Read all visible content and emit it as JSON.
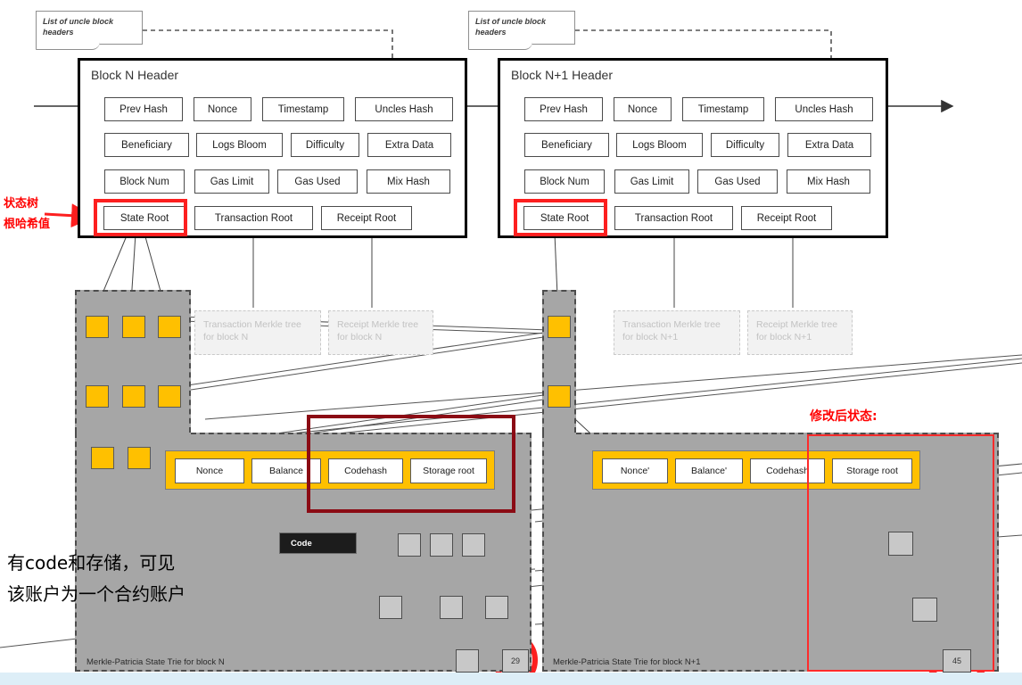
{
  "notes": [
    {
      "id": "uncle-note-left",
      "text": "List of uncle block headers"
    },
    {
      "id": "uncle-note-right",
      "text": "List of uncle block headers"
    }
  ],
  "blocks": [
    {
      "id": "block-n",
      "title": "Block N Header",
      "rows": [
        [
          "Prev Hash",
          "Nonce",
          "Timestamp",
          "Uncles Hash"
        ],
        [
          "Beneficiary",
          "Logs Bloom",
          "Difficulty",
          "Extra Data"
        ],
        [
          "Block Num",
          "Gas Limit",
          "Gas Used",
          "Mix  Hash"
        ],
        [
          "State Root",
          "Transaction Root",
          "Receipt Root"
        ]
      ]
    },
    {
      "id": "block-n1",
      "title": "Block N+1 Header",
      "rows": [
        [
          "Prev Hash",
          "Nonce",
          "Timestamp",
          "Uncles Hash"
        ],
        [
          "Beneficiary",
          "Logs Bloom",
          "Difficulty",
          "Extra Data"
        ],
        [
          "Block Num",
          "Gas Limit",
          "Gas Used",
          "Mix  Hash"
        ],
        [
          "State Root",
          "Transaction Root",
          "Receipt Root"
        ]
      ]
    }
  ],
  "ghost_boxes": [
    {
      "id": "tx-merkle-n",
      "text": "Transaction Merkle tree for block N"
    },
    {
      "id": "receipt-merkle-n",
      "text": "Receipt  Merkle tree for block N"
    },
    {
      "id": "tx-merkle-n1",
      "text": "Transaction Merkle tree for block N+1"
    },
    {
      "id": "receipt-merkle-n1",
      "text": "Receipt  Merkle tree for block N+1"
    }
  ],
  "trie_labels": [
    {
      "id": "trie-label-n",
      "text": "Merkle-Patricia  State  Trie  for block N"
    },
    {
      "id": "trie-label-n1",
      "text": "Merkle-Patricia  State  Trie  for block N+1"
    }
  ],
  "accounts": {
    "left": {
      "id": "account-n",
      "slots": [
        "Nonce",
        "Balance",
        "Codehash",
        "Storage root"
      ]
    },
    "right": {
      "id": "account-n1",
      "slots": [
        "Nonce'",
        "Balance'",
        "Codehash",
        "Storage root"
      ]
    }
  },
  "code_box": {
    "label": "Code"
  },
  "leaf_values": {
    "left": "29",
    "right": "45"
  },
  "annotations": {
    "state_root_cn_line1": "状态树",
    "state_root_cn_line2": "根哈希值",
    "contract_cn_line1": "有code和存储，可见",
    "contract_cn_line2": "该账户为一个合约账户",
    "modified_state_cn": "修改后状态:"
  },
  "colors": {
    "yellow": "#ffc000",
    "grey_region": "#a6a6a6",
    "red_highlight": "#fd1f1f",
    "dark_red": "#8b0b14",
    "grey_node": "#c8c8c8",
    "annotation_red": "#ff0000"
  }
}
